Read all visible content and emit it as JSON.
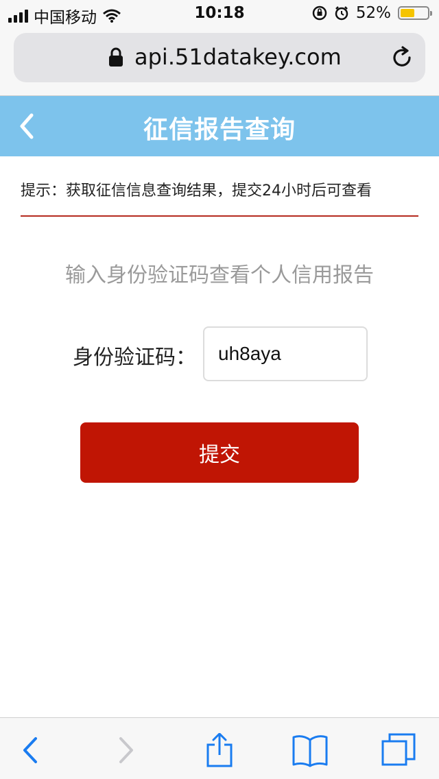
{
  "status_bar": {
    "carrier": "中国移动",
    "time": "10:18",
    "battery": "52%",
    "battery_level": 0.52,
    "battery_color": "#f5c400"
  },
  "browser": {
    "url": "api.51datakey.com",
    "icons": {
      "lock": "lock-icon",
      "reload": "reload-icon",
      "back": "back-arrow-icon",
      "forward": "forward-arrow-icon",
      "share": "share-icon",
      "bookmarks": "bookmarks-icon",
      "tabs": "tabs-icon"
    }
  },
  "header": {
    "title": "征信报告查询",
    "back_icon": "chevron-left-icon",
    "background": "#7dc3ec"
  },
  "notice": {
    "text": "提示：获取征信信息查询结果，提交24小时后可查看",
    "line_color": "#b52a1e"
  },
  "form": {
    "subtitle": "输入身份验证码查看个人信用报告",
    "code_label": "身份验证码：",
    "code_value": "uh8aya",
    "submit_label": "提交",
    "submit_color": "#c01504"
  }
}
